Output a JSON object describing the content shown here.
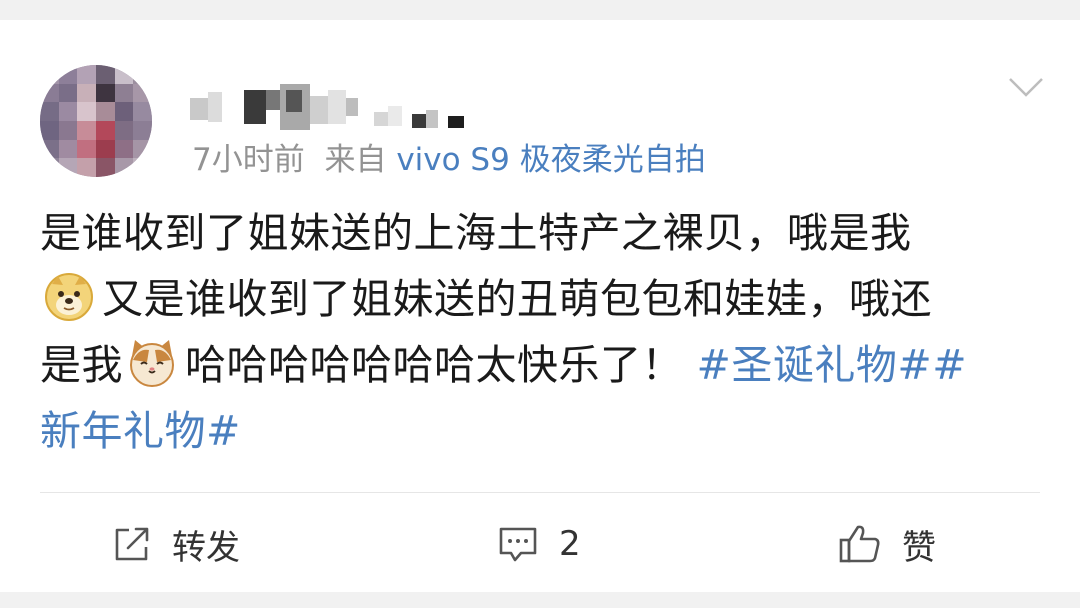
{
  "post": {
    "time_ago": "7小时前",
    "source_prefix": "来自",
    "source_device": "vivo S9 极夜柔光自拍",
    "text": {
      "line1": "是谁收到了姐妹送的上海土特产之裸贝，哦是我",
      "line2": "又是谁收到了姐妹送的丑萌包包和娃娃，哦还",
      "line3_start": "是我",
      "line3_mid": "哈哈哈哈哈哈哈太快乐了！",
      "hashtag1": "#圣诞礼物#",
      "hashtag2_part1": "#",
      "hashtag2_part2": "新年礼物#"
    },
    "emojis": [
      "doge-emoji",
      "cat-emoji"
    ]
  },
  "actions": {
    "repost_label": "转发",
    "comment_count": "2",
    "like_label": "赞"
  },
  "colors": {
    "link": "#4a7fbf",
    "meta": "#939393",
    "text": "#1a1a1a"
  }
}
